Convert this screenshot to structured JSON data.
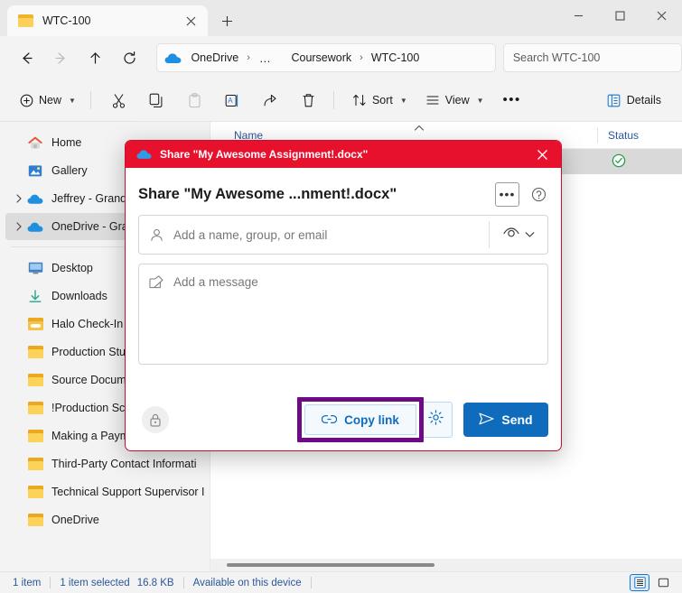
{
  "window": {
    "tab": {
      "title": "WTC-100",
      "icon": "folder-icon",
      "close_icon": "close-icon"
    },
    "new_tab_label": "+",
    "controls": {
      "minimize": "–",
      "maximize": "□",
      "close": "✕"
    }
  },
  "nav": {
    "back": "back-arrow-icon",
    "forward": "forward-arrow-icon",
    "up": "up-arrow-icon",
    "refresh": "refresh-icon",
    "breadcrumb": [
      {
        "label": "OneDrive",
        "icon": "cloud-icon"
      },
      {
        "label": "…",
        "icon": "overflow-icon"
      },
      {
        "label": "Coursework",
        "icon": ""
      },
      {
        "label": "WTC-100",
        "icon": ""
      }
    ],
    "separator": "›",
    "search_placeholder": "Search WTC-100"
  },
  "toolbar": {
    "new_label": "New",
    "cut_label": "Cut",
    "copy_label": "Copy",
    "paste_label": "Paste",
    "rename_label": "Rename",
    "share_label": "Share",
    "delete_label": "Delete",
    "sort_label": "Sort",
    "view_label": "View",
    "more_label": "•••",
    "details_label": "Details"
  },
  "sidebar": {
    "items": [
      {
        "label": "Home",
        "icon": "home-icon",
        "expandable": false,
        "selected": false
      },
      {
        "label": "Gallery",
        "icon": "gallery-icon",
        "expandable": false,
        "selected": false
      },
      {
        "label": "Jeffrey - Grand C",
        "icon": "onedrive-cloud-icon",
        "expandable": true,
        "selected": false
      },
      {
        "label": "OneDrive - Gran",
        "icon": "onedrive-cloud-icon",
        "expandable": true,
        "selected": true
      }
    ],
    "items2": [
      {
        "label": "Desktop",
        "icon": "desktop-icon",
        "pinned": false
      },
      {
        "label": "Downloads",
        "icon": "downloads-icon",
        "pinned": false
      },
      {
        "label": "Halo Check-In F",
        "icon": "folder-special-icon",
        "pinned": false
      },
      {
        "label": "Production Stuff",
        "icon": "folder-icon",
        "pinned": false
      },
      {
        "label": "Source Documen",
        "icon": "folder-icon",
        "pinned": false
      },
      {
        "label": "!Production Scre",
        "icon": "folder-icon",
        "pinned": false
      },
      {
        "label": "Making a Payment Online",
        "icon": "folder-icon",
        "pinned": true
      },
      {
        "label": "Third-Party Contact Informati",
        "icon": "folder-icon",
        "pinned": false
      },
      {
        "label": "Technical Support Supervisor I",
        "icon": "folder-icon",
        "pinned": false
      },
      {
        "label": "OneDrive",
        "icon": "folder-icon",
        "pinned": false
      }
    ],
    "pin_icon": "pin-icon"
  },
  "filelist": {
    "columns": [
      "Name",
      "Status"
    ],
    "sort_indicator": "chevron-up-icon",
    "row_status_icon": "available-on-device-icon"
  },
  "dialog": {
    "titlebar_text": "Share \"My Awesome Assignment!.docx\"",
    "titlebar_icon": "onedrive-cloud-icon",
    "titlebar_color": "#e8112d",
    "close_icon": "close-icon",
    "heading": "Share \"My Awesome ...nment!.docx\"",
    "more_options_label": "•••",
    "help_icon": "help-circle-icon",
    "people_placeholder": "Add a name, group, or email",
    "people_icon": "person-icon",
    "permission_icon": "eye-icon",
    "permission_chevron": "chevron-down-icon",
    "message_placeholder": "Add a message",
    "message_icon": "compose-icon",
    "lock_icon": "lock-icon",
    "copy_link_label": "Copy link",
    "copy_link_icon": "link-icon",
    "settings_icon": "gear-icon",
    "send_label": "Send",
    "send_icon": "send-icon",
    "highlight_color": "#6f0a86",
    "accent_color": "#0f6cbd"
  },
  "statusbar": {
    "item_count": "1 item",
    "selection": "1 item selected",
    "size": "16.8 KB",
    "availability": "Available on this device",
    "view_details_icon": "details-view-icon",
    "view_tiles_icon": "tiles-view-icon"
  }
}
